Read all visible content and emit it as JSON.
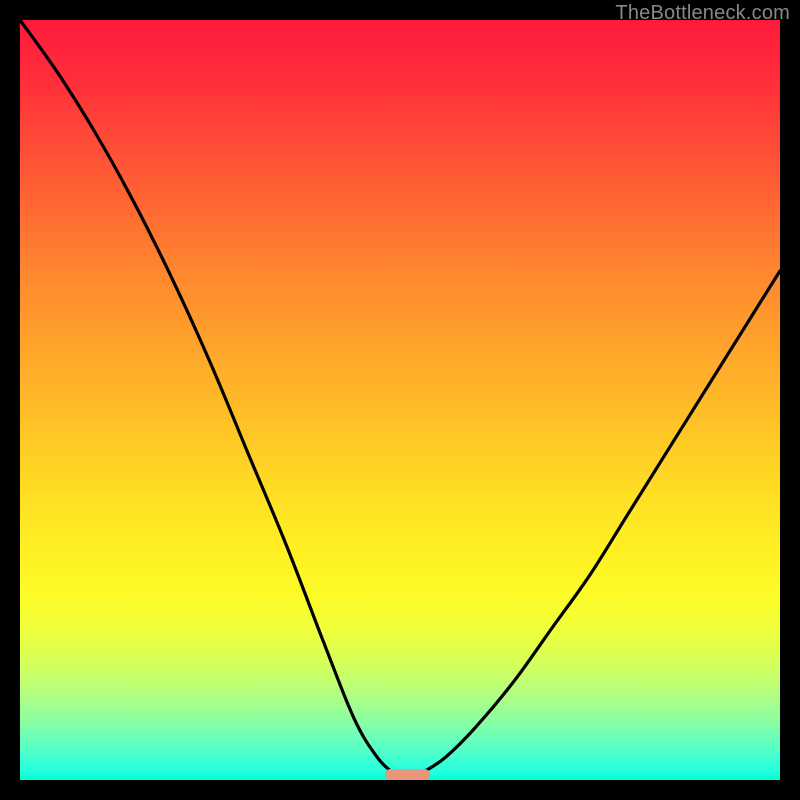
{
  "watermark": "TheBottleneck.com",
  "chart_data": {
    "type": "line",
    "title": "",
    "xlabel": "",
    "ylabel": "",
    "xlim": [
      0,
      100
    ],
    "ylim": [
      0,
      100
    ],
    "grid": false,
    "legend": false,
    "background_gradient": {
      "orientation": "vertical",
      "stops": [
        {
          "pos": 0,
          "color": "#ff1a3c"
        },
        {
          "pos": 50,
          "color": "#ffc826"
        },
        {
          "pos": 100,
          "color": "#00ffd0"
        }
      ]
    },
    "series": [
      {
        "name": "left-curve",
        "x": [
          0,
          5,
          10,
          15,
          20,
          25,
          30,
          35,
          40,
          44,
          47,
          49
        ],
        "y": [
          100,
          93,
          85,
          76,
          66,
          55,
          43,
          31,
          18,
          8,
          3,
          1
        ]
      },
      {
        "name": "right-curve",
        "x": [
          53,
          56,
          60,
          65,
          70,
          75,
          80,
          85,
          90,
          95,
          100
        ],
        "y": [
          1,
          3,
          7,
          13,
          20,
          27,
          35,
          43,
          51,
          59,
          67
        ]
      }
    ],
    "marker": {
      "shape": "rounded-rect",
      "color": "#e9967a",
      "x_center": 51,
      "y_center": 0.7,
      "width": 6,
      "height": 1.4
    }
  },
  "plot_geometry": {
    "inner_left": 20,
    "inner_top": 20,
    "inner_width": 760,
    "inner_height": 760
  }
}
